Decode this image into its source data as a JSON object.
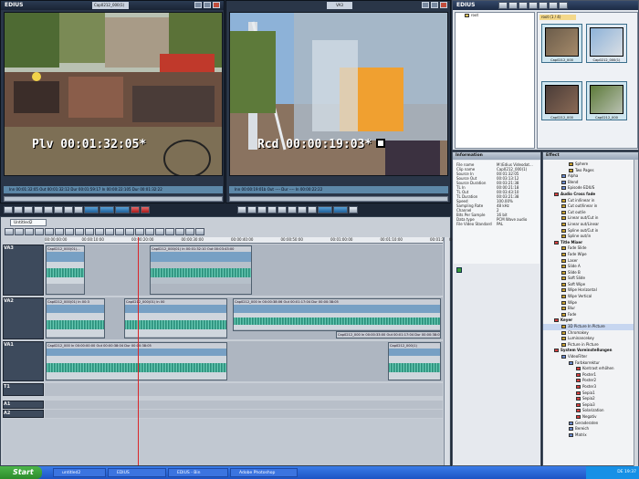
{
  "player": {
    "title": "EDIUS",
    "clip_tab": "Cap0212_000(1)",
    "timecode": "Plv 00:01:32:05*",
    "bar": "Inn 00:01:32:05    Out 00:01:32:12    Dur 00:01:59:17    In 00:00:22:105    Dur 00:01:32:22"
  },
  "recorder": {
    "tab": "VA3",
    "timecode": "Rcd 00:00:19:03*",
    "bar": "Inn 00:00:19:01b    Out ----    Dur ----    In 00:00:22:22"
  },
  "bin": {
    "title": "EDIUS",
    "folder": "root",
    "root_tab": "root (1 / 4)",
    "clips": [
      "Cap0212_000",
      "Cap0212_000(1)",
      "Cap0212_000",
      "Cap0212_000"
    ]
  },
  "information": {
    "title": "Information",
    "rows": [
      {
        "k": "File name",
        "v": "M:\\Edius Videodat..."
      },
      {
        "k": "Clip name",
        "v": "Cap0212_000(1)"
      },
      {
        "k": "Source In",
        "v": "00:01:32:05"
      },
      {
        "k": "Source Out",
        "v": "00:03:13:12"
      },
      {
        "k": "Source Duration",
        "v": "00:03:21:38"
      },
      {
        "k": "TL In",
        "v": "00:00:21:18"
      },
      {
        "k": "TL Out",
        "v": "00:03:43:10"
      },
      {
        "k": "TL Duration",
        "v": "00:03:21:38"
      },
      {
        "k": "Speed",
        "v": "100.00%"
      },
      {
        "k": "Sampling Rate",
        "v": "48 kHz"
      },
      {
        "k": "Channel",
        "v": "2"
      },
      {
        "k": "Bits Per Sample",
        "v": "16 bit"
      },
      {
        "k": "Data type",
        "v": "PCM Wave audio"
      },
      {
        "k": "File Video Standard",
        "v": "PAL"
      }
    ]
  },
  "effect": {
    "title": "Effect",
    "items": [
      {
        "label": "Sphere",
        "indent": 3,
        "color": "#c8a030"
      },
      {
        "label": "Two Pages",
        "indent": 3,
        "color": "#c8a030"
      },
      {
        "label": "Alpha",
        "indent": 2,
        "color": "#6a8bd0"
      },
      {
        "label": "Blend",
        "indent": 2,
        "color": "#6a8bd0"
      },
      {
        "label": "Episode EDIUS",
        "indent": 2,
        "color": "#6a8bd0"
      },
      {
        "label": "Audio Cross fade",
        "indent": 1,
        "color": "#d84040",
        "bold": true
      },
      {
        "label": "Cut in/linear in",
        "indent": 2,
        "color": "#c8a030"
      },
      {
        "label": "Cut out/linear in",
        "indent": 2,
        "color": "#c8a030"
      },
      {
        "label": "Cut out/ie",
        "indent": 2,
        "color": "#c8a030"
      },
      {
        "label": "Linear out/Cut in",
        "indent": 2,
        "color": "#c8a030"
      },
      {
        "label": "Linear out/Linear",
        "indent": 2,
        "color": "#c8a030"
      },
      {
        "label": "Spline out/Cut in",
        "indent": 2,
        "color": "#c8a030"
      },
      {
        "label": "Spline out/in",
        "indent": 2,
        "color": "#c8a030"
      },
      {
        "label": "Title Mixer",
        "indent": 1,
        "color": "#d84040",
        "bold": true
      },
      {
        "label": "Fade Slide",
        "indent": 2,
        "color": "#c8a030"
      },
      {
        "label": "Fade Wipe",
        "indent": 2,
        "color": "#c8a030"
      },
      {
        "label": "Laser",
        "indent": 2,
        "color": "#c8a030"
      },
      {
        "label": "Slide A",
        "indent": 2,
        "color": "#c8a030"
      },
      {
        "label": "Slide B",
        "indent": 2,
        "color": "#c8a030"
      },
      {
        "label": "Soft Slide",
        "indent": 2,
        "color": "#c8a030"
      },
      {
        "label": "Soft Wipe",
        "indent": 2,
        "color": "#c8a030"
      },
      {
        "label": "Wipe Horizontal",
        "indent": 2,
        "color": "#c8a030"
      },
      {
        "label": "Wipe Vertical",
        "indent": 2,
        "color": "#c8a030"
      },
      {
        "label": "Wipe",
        "indent": 2,
        "color": "#c8a030"
      },
      {
        "label": "Blur",
        "indent": 2,
        "color": "#c8a030"
      },
      {
        "label": "Fade",
        "indent": 2,
        "color": "#c8a030"
      },
      {
        "label": "Keyer",
        "indent": 1,
        "color": "#d84040",
        "bold": true
      },
      {
        "label": "3D Picture In Picture",
        "indent": 2,
        "color": "#c8a030",
        "selected": true
      },
      {
        "label": "Chromakey",
        "indent": 2,
        "color": "#c8a030"
      },
      {
        "label": "Luminancekey",
        "indent": 2,
        "color": "#c8a030"
      },
      {
        "label": "Picture in Picture",
        "indent": 2,
        "color": "#c8a030"
      },
      {
        "label": "System Voreinstellungen",
        "indent": 1,
        "color": "#d84040",
        "bold": true
      },
      {
        "label": "VideoFilter",
        "indent": 2,
        "color": "#6a8bd0"
      },
      {
        "label": "Farbkorrektur",
        "indent": 3,
        "color": "#6a8bd0"
      },
      {
        "label": "Kontrast erhöhen",
        "indent": 4,
        "color": "#d84040"
      },
      {
        "label": "Poster1",
        "indent": 4,
        "color": "#d84040"
      },
      {
        "label": "Poster2",
        "indent": 4,
        "color": "#d84040"
      },
      {
        "label": "Poster3",
        "indent": 4,
        "color": "#d84040"
      },
      {
        "label": "Sepia1",
        "indent": 4,
        "color": "#d84040"
      },
      {
        "label": "Sepia2",
        "indent": 4,
        "color": "#d84040"
      },
      {
        "label": "Sepia3",
        "indent": 4,
        "color": "#d84040"
      },
      {
        "label": "Solarization",
        "indent": 4,
        "color": "#d84040"
      },
      {
        "label": "Negativ",
        "indent": 4,
        "color": "#d84040"
      },
      {
        "label": "Geraderaten",
        "indent": 3,
        "color": "#6a8bd0"
      },
      {
        "label": "Bereich",
        "indent": 3,
        "color": "#6a8bd0"
      },
      {
        "label": "Matrix",
        "indent": 3,
        "color": "#6a8bd0"
      }
    ]
  },
  "timeline": {
    "tab": "Untitled2",
    "ruler": [
      "00:00:00:00",
      "00:00:10:00",
      "00:00:20:00",
      "00:00:30:00",
      "00:00:40:00",
      "00:00:50:00",
      "00:01:00:00",
      "00:01:10:00",
      "00:01:20:00"
    ],
    "tracks": {
      "va3": "VA3",
      "va2": "VA2",
      "va1": "VA1",
      "t1": "T1",
      "a1": "A1",
      "a2": "A2"
    },
    "clips": {
      "va3_a": "Cap0212_000(01)...",
      "va3_b": "Cap0212_000(01) In 00:01:32:10 Out 00:03:43:00",
      "va2_a": "Cap0212_000(01) In 00:3",
      "va2_b": "Cap0212_000(01) In 00",
      "va2_c": "Cap0212_000 In 00:00:38:06 Out 00:01:17:04 Dur 00:00:38:05",
      "va2_d": "Cap0212_000 In 00:00:33:00 Out 00:01:17:04 Dur 00:00:38:05",
      "va1_a": "Cap0212_000 In 00:00:00:00 Out 00:00:38:04 Dur 00:00:38:05",
      "va1_b": "Cap0212_000(1)"
    }
  },
  "taskbar": {
    "start": "Start",
    "tasks": [
      "untitled2",
      "EDIUS",
      "EDIUS - Bin",
      "Adobe Photoshop"
    ],
    "clock": "DE  19:37"
  }
}
